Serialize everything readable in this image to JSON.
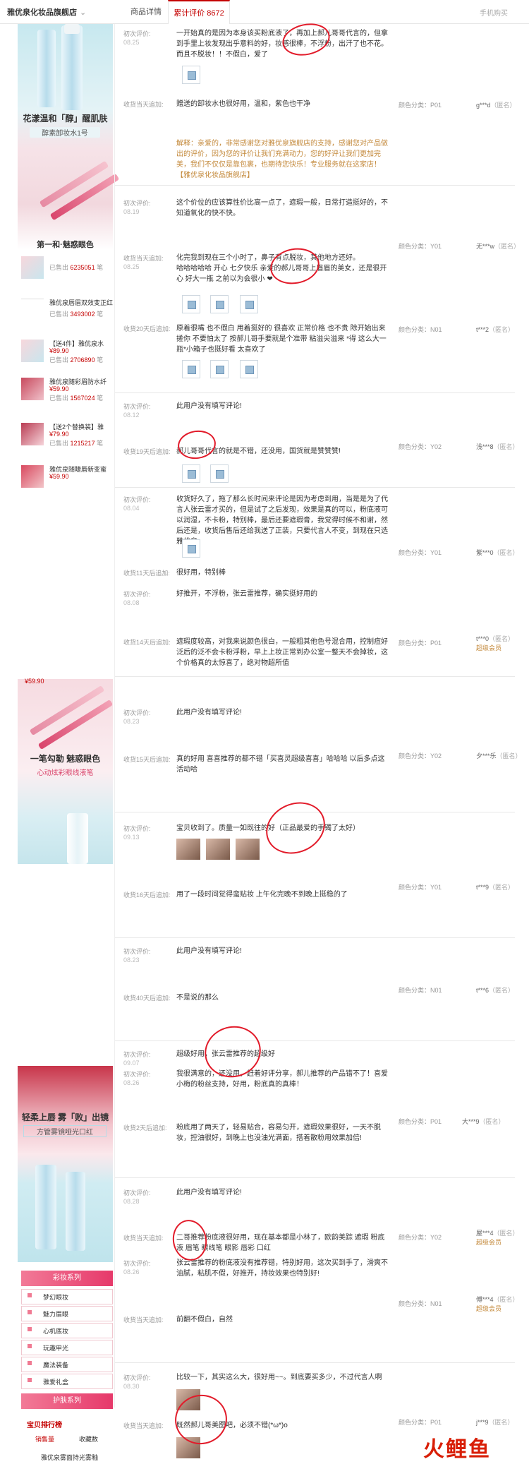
{
  "header": {
    "shop_name": "雅优泉化妆品旗舰店",
    "tab_detail": "商品详情",
    "tab_reviews": "累计评价 8672",
    "right_text": "手机购买"
  },
  "promo1": {
    "title": "花漾温和「醇」醒肌肤",
    "subtitle": "醇素卸妆水1号",
    "cut_text": "第一和·魅惑眼色"
  },
  "promo2": {
    "title": "一笔勾勒 魅惑眼色",
    "subtitle": "心动炫彩眼线液笔",
    "price": "¥59.90"
  },
  "promo3": {
    "title": "轻柔上唇 雾「败」出镜",
    "subtitle": "方管雾镜哑光口红"
  },
  "side_items": [
    {
      "name": "",
      "price": "",
      "sold_label": "已售出",
      "sold": "6235051",
      "unit": "笔"
    },
    {
      "name": "雅优泉唇眉双效变正红",
      "price": "",
      "sold_label": "已售出",
      "sold": "3493002",
      "unit": "笔"
    },
    {
      "name": "【送4件】雅优泉水",
      "price": "¥89.90",
      "sold_label": "已售出",
      "sold": "2706890",
      "unit": "笔"
    },
    {
      "name": "雅优泉随彩眉防水纤",
      "price": "¥59.90",
      "sold_label": "已售出",
      "sold": "1567024",
      "unit": "笔"
    },
    {
      "name": "【送2个替换装】雅",
      "price": "¥79.90",
      "sold_label": "已售出",
      "sold": "1215217",
      "unit": "笔"
    },
    {
      "name": "雅优泉随睫唇新变蜜",
      "price": "¥59.90",
      "sold_label": "",
      "sold": "",
      "unit": ""
    }
  ],
  "reviews": [
    {
      "label": "初次评价:",
      "date": "08.25",
      "text": "一开始真的是因为本身该买粉底液了，再加上郝儿哥哥代言的，但拿到手里上妆发现出乎意料的好，妆感很棒，不浮粉，出汗了也不花。而且不脱妆！！不假白，爱了"
    },
    {
      "label": "收货当天追加:",
      "text": "赠送的卸妆水也很好用，温和，紫色也干净",
      "color": "颜色分类：P01",
      "user": "g***d",
      "anon": "（匿名）"
    },
    {
      "label": "",
      "text": "解释：亲爱的，非常感谢您对雅优泉旗舰店的支持，感谢您对产品做出的评价，因为您的评价让我们充满动力，您的好评让我们更加完美，我们不仅仅是靠包裹，也期待您快乐！专业服务就在这家店！【雅优泉化妆品旗舰店】"
    },
    {
      "label": "初次评价:",
      "date": "08.19",
      "text": "这个价位的应该算性价比高一点了，遮瑕一般，日常打造挺好的，不知道氧化的快不快。",
      "color": "颜色分类：Y01",
      "user": "无***w",
      "anon": "（匿名）"
    },
    {
      "label": "收货当天追加:",
      "date": "08.25",
      "text": "化完我到现在三个小时了，鼻子有点脱妆，其他地方还好。",
      "text2": "哈哈哈哈哈 开心 七夕快乐 亲爱的郝儿哥哥上眉眉的美女，还是很开心 好大一瓶 之前以为会很小 ❤"
    },
    {
      "label": "收货20天后追加:",
      "text": "原着很嘴 也不假白 用着挺好的 很喜欢 正常价格 也不贵 除开始出来搓你 不要怕太了 按郝儿哥手要就是个准带 粘溢尖溢来 *得 这么大一瓶*小箱子也挺好看 太喜欢了",
      "color": "颜色分类：N01",
      "user": "t***2",
      "anon": "（匿名）"
    },
    {
      "label": "初次评价:",
      "date": "08.12",
      "text": "此用户没有填写评论!"
    },
    {
      "label": "收货19天后追加:",
      "text": "郝儿哥哥代言的就是不错，还没用，国货就是赞赞赞!",
      "color": "颜色分类：Y02",
      "user": "浅***8",
      "anon": "（匿名）"
    },
    {
      "label": "初次评价:",
      "date": "08.04",
      "text": "收货好久了，拖了那么长时间来评论是因为考虑到用，当是是为了代言人张云雷才买的，但是试了之后发现，效果是真的可以，粉底液可以润湿，不卡粉，特别棒，最后还要遮瑕膏，我觉得时候不和谢，然后还是，收货后售后还给我送了正装，只要代言人不变，到现在只选雅优泉",
      "color": "颜色分类：Y01",
      "user": "紫***0",
      "anon": "（匿名）"
    },
    {
      "label": "收货11天后追加:",
      "text": "很好用，特别棒"
    },
    {
      "label": "初次评价:",
      "date": "08.08",
      "text": "好推开，不浮粉，张云雷推荐，确实挺好用的"
    },
    {
      "label": "收货14天后追加:",
      "text": "遮瑕度较高，对我来说颜色很白，一般粗其他色号混合用，控制痘好泛后的泛不会卡粉浮粉，早上上妆正常到办公室一整天不会掉妆，这个价格真的太惊喜了，绝对物超所值",
      "color": "颜色分类：P01",
      "user": "t***0",
      "anon": "（匿名）",
      "vip": "超级会员"
    },
    {
      "label": "初次评价:",
      "date": "08.23",
      "text": "此用户没有填写评论!"
    },
    {
      "label": "收货15天后追加:",
      "text": "真的好用 喜喜推荐的都不错「买喜灵超级喜喜」哈哈哈 以后多点这活动哈",
      "color": "颜色分类：Y02",
      "user": "夕***乐",
      "anon": "（匿名）"
    },
    {
      "label": "初次评价:",
      "date": "09.13",
      "text": "宝贝收到了。质量一如既往的好（正品最爱的手镯了太好）"
    },
    {
      "label": "收货16天后追加:",
      "text": "用了一段时间觉得蛮贴妆 上午化完晚不到晚上挺稳的了",
      "color": "颜色分类：Y01",
      "user": "t***9",
      "anon": "（匿名）"
    },
    {
      "label": "初次评价:",
      "date": "08.23",
      "text": "此用户没有填写评论!"
    },
    {
      "label": "收货40天后追加:",
      "text": "不是说的那么",
      "color": "颜色分类：N01",
      "user": "t***6",
      "anon": "（匿名）"
    },
    {
      "label": "初次评价:",
      "date": "09.07",
      "text": "超级好用，张云雷推荐的超级好"
    },
    {
      "label": "初次评价:",
      "date": "08.26",
      "text": "我很满意的，还没用，赶着好评分享，郝儿推荐的产品错不了！喜爱小梅的粉丝支持，好用，粉底真的真棒！"
    },
    {
      "label": "收货2天后追加:",
      "text": "粉底用了两天了，轻易贴合，容易匀开，遮瑕效果很好，一天不脱妆，控油很好，到晚上也没油光满面，搭着散粉用效果加倍!",
      "color": "颜色分类：P01",
      "user": "大***9",
      "anon": "（匿名）"
    },
    {
      "label": "初次评价:",
      "date": "08.28",
      "text": "此用户没有填写评论!"
    },
    {
      "label": "收货当天追加:",
      "text": "二哥推荐粉底液很好用，现在基本都是小林了，欧韵美踪 遮瑕 粉底液 眉笔 眼线笔 眼影 唇彩 口红",
      "color": "颜色分类：Y02",
      "user": "屋***4",
      "anon": "（匿名）",
      "vip": "超级会员"
    },
    {
      "label": "初次评价:",
      "date": "08.26",
      "text": "张云雷推荐的粉底液没有推荐错，特别好用，这次买到手了，滑爽不油腻，粘肌不假，好推开，持妆效果也特别好!"
    },
    {
      "label": "收货当天追加:",
      "text": "前翻不假白，自然",
      "color": "颜色分类：N01",
      "user": "傅***4",
      "anon": "（匿名）",
      "vip": "超级会员"
    },
    {
      "label": "初次评价:",
      "date": "08.30",
      "text": "比较一下，其实这么大，很好用~~。到底要买多少，不过代言人啊"
    },
    {
      "label": "收货当天追加:",
      "text": "既然郝儿哥美图吧，必须不错(*ω*)o",
      "color": "颜色分类：P01",
      "user": "j***9",
      "anon": "（匿名）"
    }
  ],
  "nav": {
    "section1": "彩妆系列",
    "cats": [
      "梦幻眼妆",
      "魅力眉眼",
      "心机底妆",
      "玩趣甲光",
      "魔法装备",
      "雅爱礼盒"
    ],
    "section2": "护肤系列",
    "ranking_title": "宝贝排行榜",
    "rank_tab1": "销售量",
    "rank_tab2": "收藏数",
    "last_item": "雅优泉雾面持光雾釉"
  },
  "watermark": {
    "text": "火鲤鱼"
  }
}
